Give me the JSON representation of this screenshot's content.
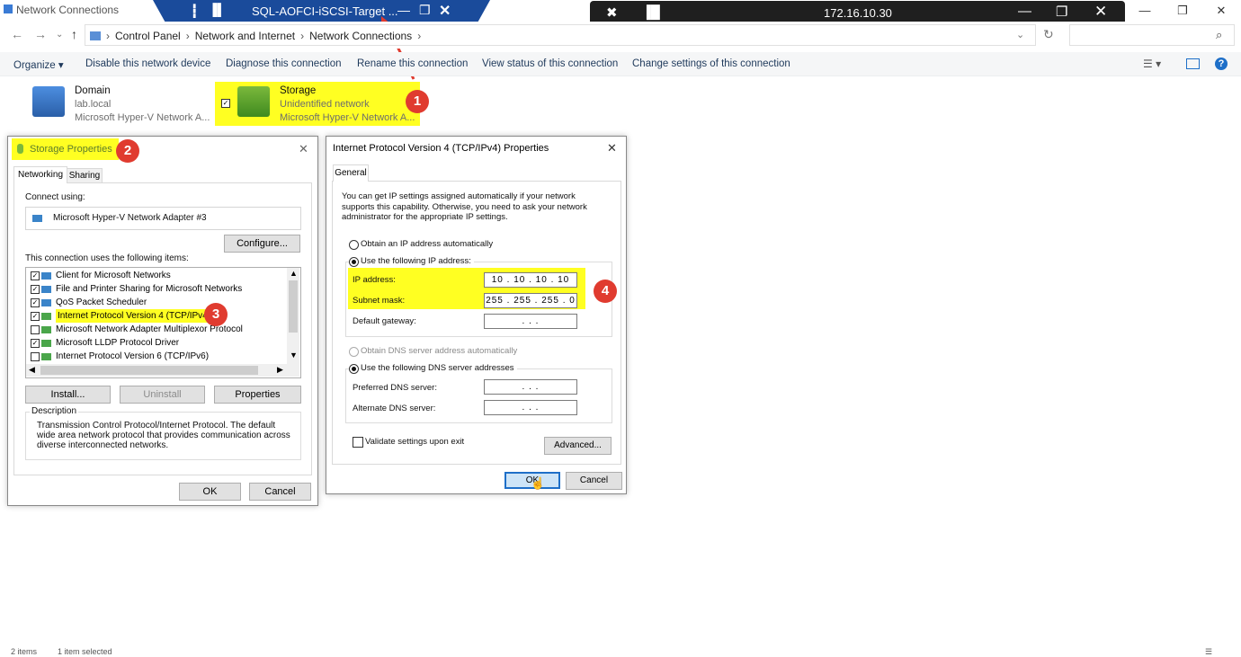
{
  "window": {
    "title": "Network Connections"
  },
  "rdp_banner": {
    "title": "SQL-AOFCI-iSCSI-Target ..."
  },
  "remote_bar": {
    "ip": "172.16.10.30"
  },
  "breadcrumb": [
    "Control Panel",
    "Network and Internet",
    "Network Connections"
  ],
  "commands": [
    "Organize",
    "Disable this network device",
    "Diagnose this connection",
    "Rename this connection",
    "View status of this connection",
    "Change settings of this connection"
  ],
  "connections": [
    {
      "name": "Domain",
      "network": "lab.local",
      "adapter": "Microsoft Hyper-V Network A..."
    },
    {
      "name": "Storage",
      "network": "Unidentified network",
      "adapter": "Microsoft Hyper-V Network A..."
    }
  ],
  "badges": [
    "1",
    "2",
    "3",
    "4"
  ],
  "storage_props": {
    "title": "Storage Properties",
    "tabs": [
      "Networking",
      "Sharing"
    ],
    "connect_using_label": "Connect using:",
    "adapter": "Microsoft Hyper-V Network Adapter #3",
    "configure": "Configure...",
    "items_label": "This connection uses the following items:",
    "items": [
      {
        "label": "Client for Microsoft Networks",
        "checked": true
      },
      {
        "label": "File and Printer Sharing for Microsoft Networks",
        "checked": true
      },
      {
        "label": "QoS Packet Scheduler",
        "checked": true
      },
      {
        "label": "Internet Protocol Version 4 (TCP/IPv4)",
        "checked": true
      },
      {
        "label": "Microsoft Network Adapter Multiplexor Protocol",
        "checked": false
      },
      {
        "label": "Microsoft LLDP Protocol Driver",
        "checked": true
      },
      {
        "label": "Internet Protocol Version 6 (TCP/IPv6)",
        "checked": false
      }
    ],
    "install": "Install...",
    "uninstall": "Uninstall",
    "properties": "Properties",
    "description_label": "Description",
    "description": "Transmission Control Protocol/Internet Protocol. The default wide area network protocol that provides communication across diverse interconnected networks.",
    "ok": "OK",
    "cancel": "Cancel"
  },
  "ipv4_props": {
    "title": "Internet Protocol Version 4 (TCP/IPv4) Properties",
    "tab": "General",
    "intro": "You can get IP settings assigned automatically if your network supports this capability. Otherwise, you need to ask your network administrator for the appropriate IP settings.",
    "obtain_ip": "Obtain an IP address automatically",
    "use_ip": "Use the following IP address:",
    "ip_label": "IP address:",
    "ip_value": "10  .  10  .  10  .  10",
    "mask_label": "Subnet mask:",
    "mask_value": "255 . 255 . 255 .  0",
    "gw_label": "Default gateway:",
    "gw_value": ".     .     .",
    "obtain_dns": "Obtain DNS server address automatically",
    "use_dns": "Use the following DNS server addresses",
    "pref_dns_label": "Preferred DNS server:",
    "pref_dns_value": ".     .     .",
    "alt_dns_label": "Alternate DNS server:",
    "alt_dns_value": ".     .     .",
    "validate": "Validate settings upon exit",
    "advanced": "Advanced...",
    "ok": "OK",
    "cancel": "Cancel"
  },
  "status": {
    "count": "2 items",
    "selected": "1 item selected"
  }
}
